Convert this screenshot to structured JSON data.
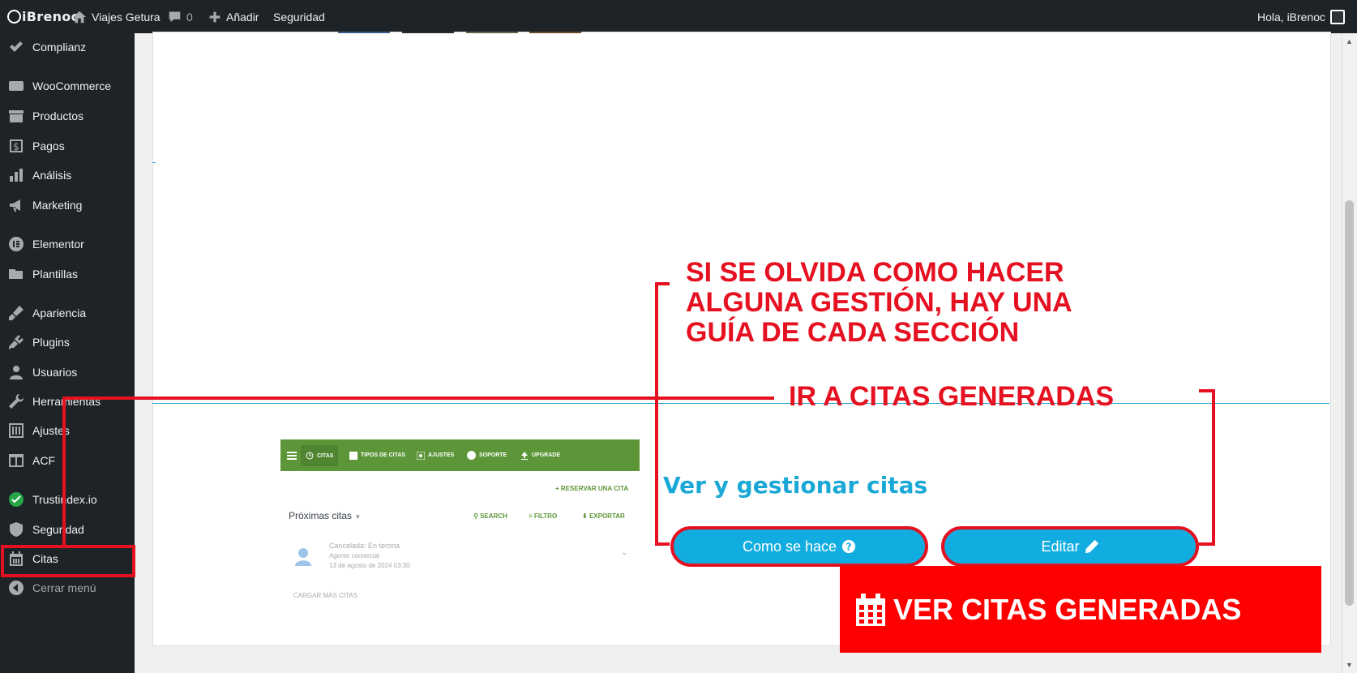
{
  "adminbar": {
    "logo": "iBrenoc",
    "site_name": "Viajes Getura",
    "comments_count": "0",
    "add_label": "Añadir",
    "security_label": "Seguridad",
    "greeting": "Hola, iBrenoc"
  },
  "sidebar": {
    "items": [
      {
        "label": "Complianz",
        "icon": "check-icon"
      },
      {
        "label": "WooCommerce",
        "icon": "woocommerce-icon"
      },
      {
        "label": "Productos",
        "icon": "archive-icon"
      },
      {
        "label": "Pagos",
        "icon": "dollar-icon"
      },
      {
        "label": "Análisis",
        "icon": "bar-chart-icon"
      },
      {
        "label": "Marketing",
        "icon": "megaphone-icon"
      },
      {
        "label": "Elementor",
        "icon": "elementor-icon"
      },
      {
        "label": "Plantillas",
        "icon": "folder-icon"
      },
      {
        "label": "Apariencia",
        "icon": "brush-icon"
      },
      {
        "label": "Plugins",
        "icon": "plug-icon"
      },
      {
        "label": "Usuarios",
        "icon": "user-icon"
      },
      {
        "label": "Herramientas",
        "icon": "wrench-icon"
      },
      {
        "label": "Ajustes",
        "icon": "sliders-icon"
      },
      {
        "label": "ACF",
        "icon": "table-icon"
      },
      {
        "label": "Trustindex.io",
        "icon": "trustindex-icon"
      },
      {
        "label": "Seguridad",
        "icon": "shield-icon"
      },
      {
        "label": "Citas",
        "icon": "calendar-icon"
      },
      {
        "label": "Cerrar menú",
        "icon": "collapse-icon"
      }
    ]
  },
  "preview": {
    "nav": [
      "CITAS",
      "TIPOS DE CITAS",
      "AJUSTES",
      "SOPORTE",
      "UPGRADE"
    ],
    "reserve": "RESERVAR UNA CITA",
    "upcoming": "Próximas citas",
    "search": "SEARCH",
    "filter": "FILTRO",
    "export": "EXPORTAR",
    "appt_status": "Cancelada: En terona",
    "appt_agent": "Agente comercial",
    "appt_date": "13 de agosto de 2024 03:30",
    "load_more": "CARGAR MÁS CITAS"
  },
  "main": {
    "section_title": "Ver y gestionar citas",
    "how_button": "Como se hace",
    "edit_button": "Editar"
  },
  "annotations": {
    "guide_line1": "SI SE OLVIDA COMO HACER",
    "guide_line2": "ALGUNA GESTIÓN, HAY UNA",
    "guide_line3": "GUÍA DE CADA SECCIÓN",
    "goto": "IR A CITAS GENERADAS",
    "banner": "VER CITAS GENERADAS"
  },
  "colors": {
    "accent_blue": "#12ade0",
    "annotation_red": "#e51020",
    "preview_green": "#5d9638",
    "admin_dark": "#1d2327"
  }
}
